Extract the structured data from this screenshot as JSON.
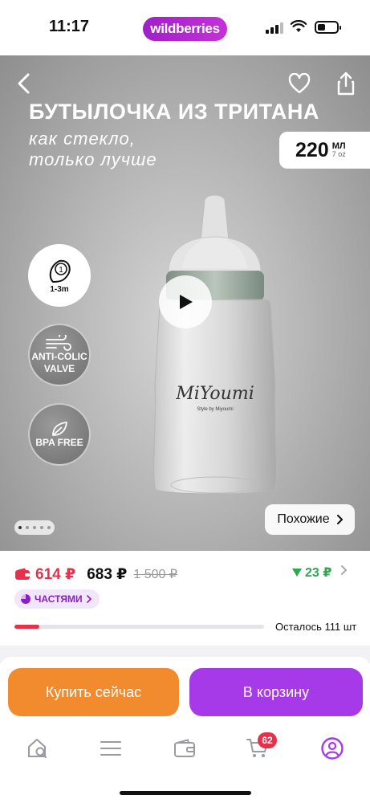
{
  "status_bar": {
    "time": "11:17",
    "brand": "wildberries"
  },
  "hero": {
    "title": "БУТЫЛОЧКА ИЗ ТРИТАНА",
    "subtitle_line1": "как стекло,",
    "subtitle_line2": "только лучше",
    "volume": {
      "value": "220",
      "unit": "МЛ",
      "alt": "7 oz"
    },
    "features": [
      {
        "text": "1-3m",
        "badge": "1"
      },
      {
        "text": "ANTI-COLIC VALVE"
      },
      {
        "text": "BPA FREE"
      }
    ],
    "brand_logo_text": "MiYoumi",
    "brand_tagline": "Style by Miyoumi",
    "slides": {
      "count": 5,
      "active": 1
    },
    "similar_label": "Похожие"
  },
  "price": {
    "wallet_price": "614 ₽",
    "price": "683 ₽",
    "old_price": "1 500 ₽",
    "delta": "23 ₽"
  },
  "installments_label": "ЧАСТЯМИ",
  "stock": {
    "text": "Осталось 111 шт",
    "fill_fraction": 0.1
  },
  "actions": {
    "buy_now": "Купить сейчас",
    "add_to_cart": "В корзину"
  },
  "tabbar": {
    "cart_count": "62"
  },
  "colors": {
    "accent_purple": "#a73ae8",
    "accent_orange": "#f28b2e",
    "price_red": "#e8304a",
    "delta_green": "#2fa84f"
  }
}
